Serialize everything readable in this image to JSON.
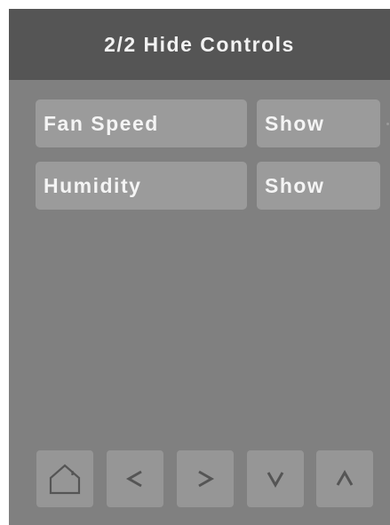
{
  "header": {
    "title": "2/2 Hide Controls"
  },
  "rows": [
    {
      "label": "Fan Speed",
      "value": "Show"
    },
    {
      "label": "Humidity",
      "value": "Show"
    }
  ],
  "nav": {
    "buttons": [
      {
        "icon": "home-icon"
      },
      {
        "icon": "chevron-left-icon"
      },
      {
        "icon": "chevron-right-icon"
      },
      {
        "icon": "chevron-down-icon"
      },
      {
        "icon": "chevron-up-icon"
      }
    ]
  },
  "colors": {
    "screen_bg": "#808080",
    "header_bg": "#555555",
    "button_bg": "#9b9b9b",
    "nav_button_bg": "#969696",
    "icon": "#555555",
    "text": "#f4f4f4"
  }
}
